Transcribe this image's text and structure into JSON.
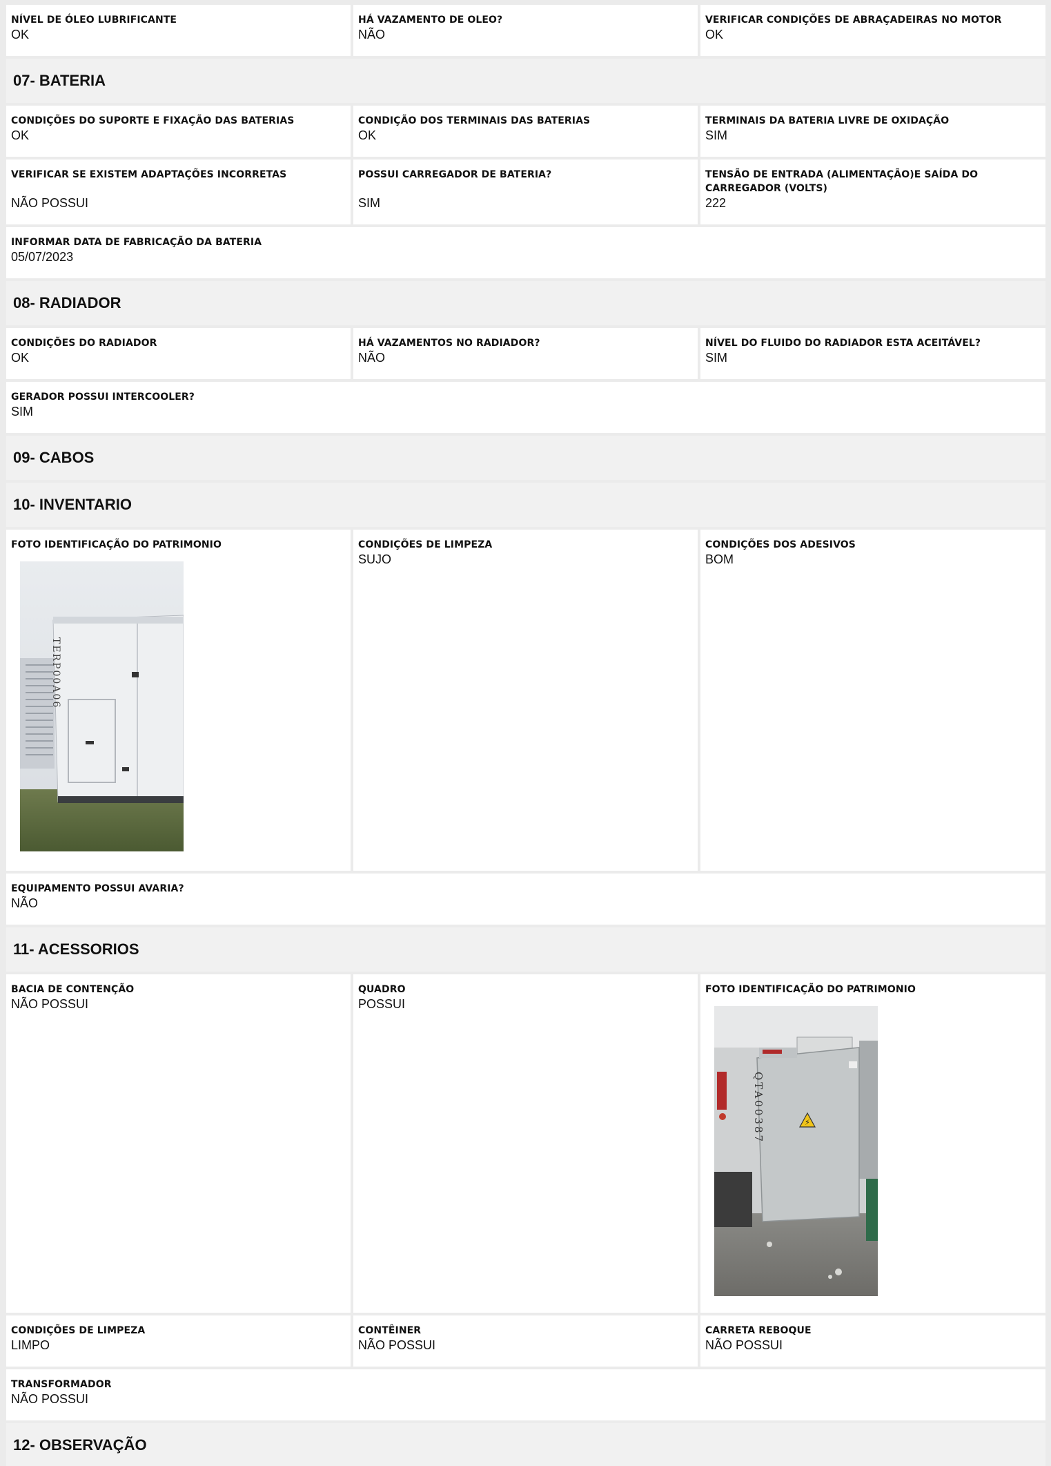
{
  "row_motor": [
    {
      "label": "NÍVEL DE ÓLEO LUBRIFICANTE",
      "value": "OK"
    },
    {
      "label": "HÁ VAZAMENTO DE OLEO?",
      "value": "NÃO"
    },
    {
      "label": "VERIFICAR CONDIÇÕES DE ABRAÇADEIRAS NO MOTOR",
      "value": "OK"
    }
  ],
  "s07": {
    "title": "07- BATERIA",
    "row1": [
      {
        "label": "CONDIÇÕES DO SUPORTE E FIXAÇÃO DAS BATERIAS",
        "value": "OK"
      },
      {
        "label": "CONDIÇÃO DOS TERMINAIS DAS BATERIAS",
        "value": "OK"
      },
      {
        "label": "TERMINAIS DA BATERIA LIVRE DE OXIDAÇÃO",
        "value": "SIM"
      }
    ],
    "row2": [
      {
        "label": "VERIFICAR SE EXISTEM ADAPTAÇÕES INCORRETAS",
        "value": "NÃO POSSUI"
      },
      {
        "label": "POSSUI CARREGADOR DE BATERIA?",
        "value": "SIM"
      },
      {
        "label": "TENSÃO DE ENTRADA (ALIMENTAÇÃO)E SAÍDA DO CARREGADOR (VOLTS)",
        "value": "222"
      }
    ],
    "row3": {
      "label": "INFORMAR DATA DE FABRICAÇÃO DA BATERIA",
      "value": "05/07/2023"
    }
  },
  "s08": {
    "title": "08- RADIADOR",
    "row1": [
      {
        "label": "CONDIÇÕES DO RADIADOR",
        "value": "OK"
      },
      {
        "label": "HÁ VAZAMENTOS NO RADIADOR?",
        "value": "NÃO"
      },
      {
        "label": "NÍVEL DO FLUIDO DO RADIADOR ESTA ACEITÁVEL?",
        "value": "SIM"
      }
    ],
    "row2": {
      "label": "GERADOR POSSUI INTERCOOLER?",
      "value": "SIM"
    }
  },
  "s09": {
    "title": "09- CABOS"
  },
  "s10": {
    "title": "10- INVENTARIO",
    "row1": [
      {
        "label": "FOTO IDENTIFICAÇÃO DO PATRIMONIO",
        "photo_text": "TERP00A06"
      },
      {
        "label": "CONDIÇÕES DE LIMPEZA",
        "value": "SUJO"
      },
      {
        "label": "CONDIÇÕES DOS ADESIVOS",
        "value": "BOM"
      }
    ],
    "row2": {
      "label": "EQUIPAMENTO POSSUI AVARIA?",
      "value": "NÃO"
    }
  },
  "s11": {
    "title": "11- ACESSORIOS",
    "row1": [
      {
        "label": "BACIA DE CONTENÇÃO",
        "value": "NÃO POSSUI"
      },
      {
        "label": "QUADRO",
        "value": "POSSUI"
      },
      {
        "label": "FOTO IDENTIFICAÇÃO DO PATRIMONIO",
        "photo_text": "QTA00387"
      }
    ],
    "row2": [
      {
        "label": "CONDIÇÕES DE LIMPEZA",
        "value": "LIMPO"
      },
      {
        "label": "CONTÊINER",
        "value": "NÃO POSSUI"
      },
      {
        "label": "CARRETA REBOQUE",
        "value": "NÃO POSSUI"
      }
    ],
    "row3": {
      "label": "TRANSFORMADOR",
      "value": "NÃO POSSUI"
    }
  },
  "s12": {
    "title": "12- OBSERVAÇÃO"
  }
}
